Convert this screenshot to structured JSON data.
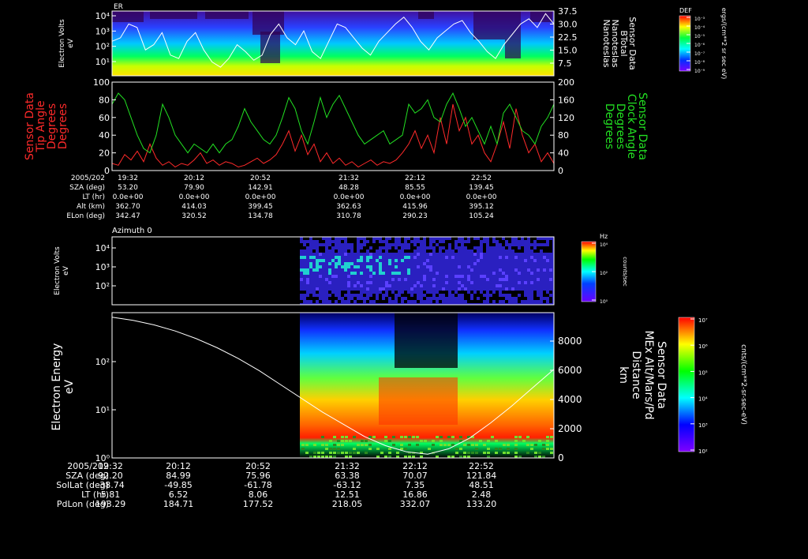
{
  "colors": {
    "background": "#000000",
    "axis": "#ffffff",
    "tip": "#ff2a2a",
    "clock": "#22e022",
    "line": "#ffffff"
  },
  "chart_data": [
    {
      "type": "heatmap",
      "panel_label": "ER",
      "ylabel": [
        "Electron Volts",
        "eV"
      ],
      "yticks": [
        "10⁴",
        "10³",
        "10²",
        "10¹"
      ],
      "right_ticks": [
        "37.5",
        "30.0",
        "22.5",
        "15.0",
        "7.5"
      ],
      "right_labels": [
        "Sensor Data",
        "BTotal",
        "Nanoteslas",
        "Nanoteslas"
      ],
      "colorbar": {
        "title": "DEF",
        "units": "ergs/(cm**2 sr sec eV)",
        "ticks": [
          "10⁻³",
          "10⁻⁴",
          "10⁻⁵",
          "10⁻⁶",
          "10⁻⁷",
          "10⁻⁸",
          "10⁻⁹"
        ]
      }
    },
    {
      "type": "line",
      "left_label": [
        "Sensor Data",
        "Tip Angle",
        "Degrees",
        "Degrees"
      ],
      "right_label": [
        "Sensor Data",
        "Clock Angle",
        "Degrees",
        "Degrees"
      ],
      "ylim_left": [
        0,
        100
      ],
      "ylim_right": [
        0,
        200
      ],
      "yticks_left": [
        "100",
        "80",
        "60",
        "40",
        "20",
        "0"
      ],
      "yticks_right": [
        "200",
        "160",
        "120",
        "80",
        "40",
        "0"
      ],
      "series": [
        {
          "name": "Tip Angle",
          "values": [
            8,
            6,
            18,
            12,
            22,
            10,
            30,
            14,
            6,
            10,
            4,
            8,
            6,
            12,
            20,
            8,
            12,
            6,
            10,
            8,
            4,
            6,
            10,
            14,
            8,
            12,
            18,
            30,
            45,
            22,
            40,
            18,
            30,
            10,
            20,
            8,
            14,
            6,
            10,
            4,
            8,
            12,
            6,
            10,
            8,
            12,
            20,
            30,
            45,
            25,
            40,
            20,
            60,
            30,
            75,
            45,
            60,
            30,
            40,
            20,
            10,
            30,
            55,
            25,
            70,
            40,
            20,
            30,
            10,
            20,
            8
          ]
        },
        {
          "name": "Clock Angle",
          "values": [
            150,
            175,
            160,
            120,
            80,
            50,
            40,
            80,
            150,
            120,
            80,
            60,
            40,
            60,
            50,
            40,
            60,
            40,
            60,
            70,
            100,
            140,
            110,
            90,
            70,
            60,
            80,
            120,
            165,
            140,
            90,
            60,
            110,
            165,
            120,
            150,
            170,
            140,
            110,
            80,
            60,
            70,
            80,
            90,
            60,
            70,
            80,
            150,
            130,
            140,
            160,
            120,
            110,
            150,
            175,
            140,
            100,
            120,
            90,
            60,
            100,
            60,
            130,
            150,
            120,
            90,
            80,
            60,
            100,
            120,
            150
          ]
        }
      ]
    },
    {
      "type": "heatmap",
      "panel_label": "Azimuth 0",
      "ylabel": [
        "Electron Volts",
        "eV"
      ],
      "yticks": [
        "10⁴",
        "10³",
        "10²"
      ],
      "colorbar": {
        "title": "Hz",
        "units": "counts/sec",
        "ticks": [
          "10⁴",
          "10²",
          "10⁰"
        ]
      }
    },
    {
      "type": "heatmap",
      "ylabel": [
        "Electron Energy",
        "eV"
      ],
      "yticks": [
        "10²",
        "10¹",
        "10⁰"
      ],
      "right_ticks": [
        "8000",
        "6000",
        "4000",
        "2000",
        "0"
      ],
      "right_labels": [
        "Sensor Data",
        "MEx Alt/Mars/Pd",
        "Distance",
        "km"
      ],
      "colorbar": {
        "units": "cnts/(cm**2-sr-sec-eV)",
        "ticks": [
          "10⁷",
          "10⁶",
          "10⁵",
          "10⁴",
          "10³",
          "10²"
        ]
      },
      "line": {
        "name": "Distance",
        "ylim": [
          0,
          9500
        ],
        "values": [
          9200,
          9000,
          8700,
          8300,
          7800,
          7200,
          6500,
          5700,
          4800,
          3900,
          3000,
          2200,
          1400,
          800,
          400,
          250,
          600,
          1300,
          2300,
          3400,
          4600,
          5800
        ]
      }
    }
  ],
  "upper_table": {
    "labels": [
      "2005/202",
      "SZA (deg)",
      "LT (hr)",
      "Alt (km)",
      "ELon (deg)"
    ],
    "columns": [
      [
        "19:32",
        "53.20",
        "0.0e+00",
        "362.70",
        "342.47"
      ],
      [
        "20:12",
        "79.90",
        "0.0e+00",
        "414.03",
        "320.52"
      ],
      [
        "20:52",
        "142.91",
        "0.0e+00",
        "399.45",
        "134.78"
      ],
      [
        "21:32",
        "48.28",
        "0.0e+00",
        "362.63",
        "310.78"
      ],
      [
        "22:12",
        "85.55",
        "0.0e+00",
        "415.96",
        "290.23"
      ],
      [
        "22:52",
        "139.45",
        "0.0e+00",
        "395.12",
        "105.24"
      ]
    ]
  },
  "lower_table": {
    "labels": [
      "2005/202",
      "SZA (deg)",
      "SolLat (deg)",
      "LT (hr)",
      "PdLon (deg)"
    ],
    "columns": [
      [
        "19:32",
        "92.20",
        "-38.74",
        "5.81",
        "193.29"
      ],
      [
        "20:12",
        "84.99",
        "-49.85",
        "6.52",
        "184.71"
      ],
      [
        "20:52",
        "75.96",
        "-61.78",
        "8.06",
        "177.52"
      ],
      [
        "21:32",
        "63.38",
        "-63.12",
        "12.51",
        "218.05"
      ],
      [
        "22:12",
        "70.07",
        "7.35",
        "16.86",
        "332.07"
      ],
      [
        "22:52",
        "121.84",
        "48.51",
        "2.48",
        "133.20"
      ]
    ]
  }
}
